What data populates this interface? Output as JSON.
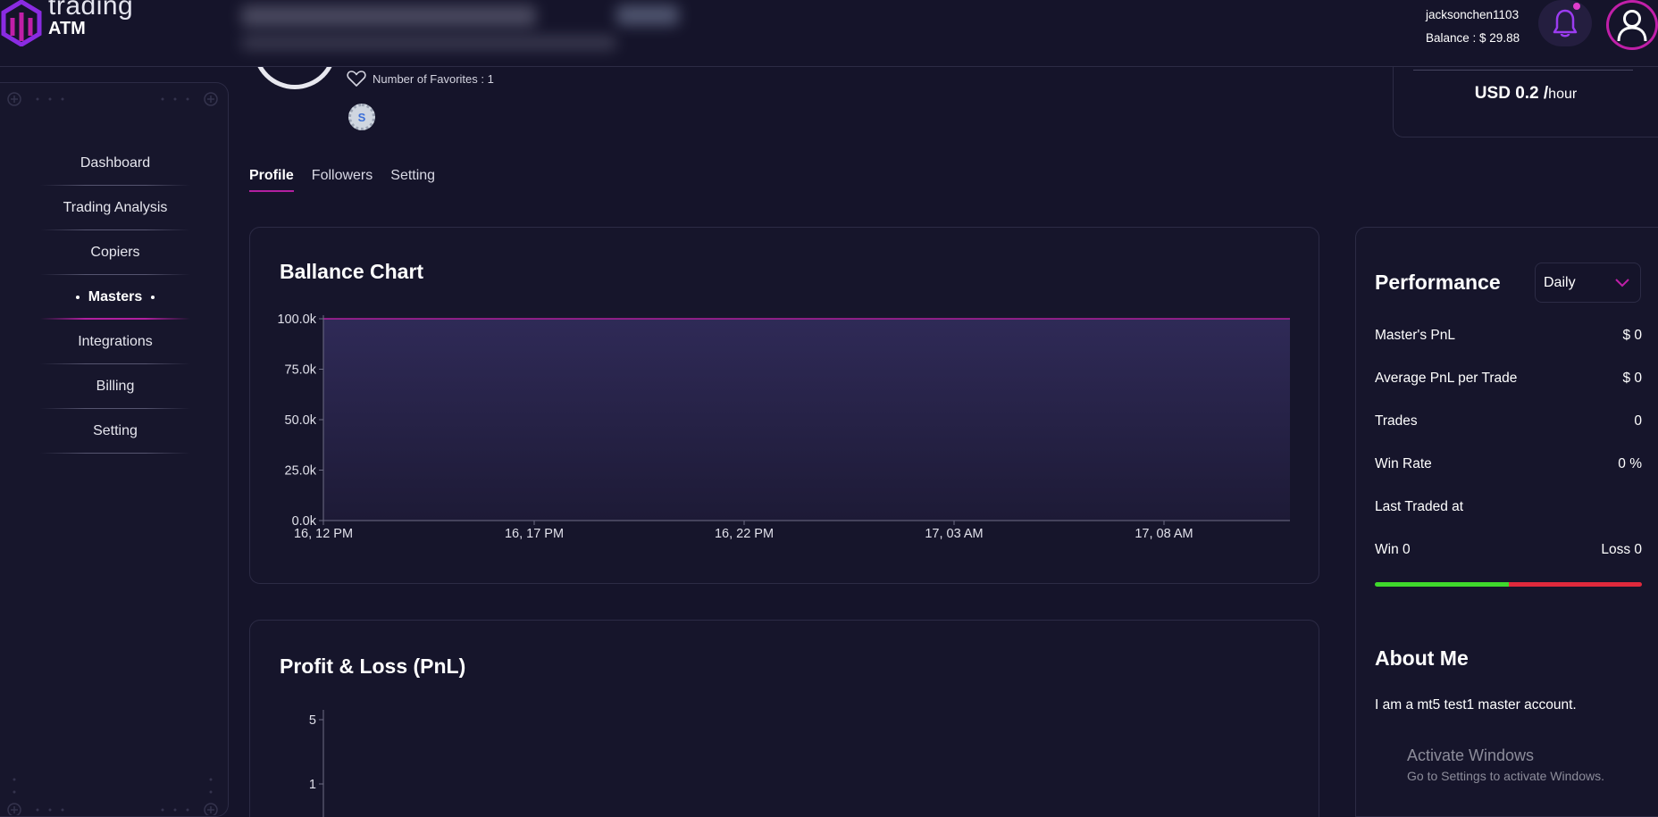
{
  "app": {
    "logo_word1": "trading",
    "logo_word2": "ATM",
    "accent_color": "#b21fa0"
  },
  "header": {
    "username": "jacksonchen1103",
    "balance": "Balance : $ 29.88",
    "bell_icon": "bell-icon",
    "avatar_icon": "user-icon"
  },
  "sidebar": {
    "items": [
      {
        "label": "Dashboard"
      },
      {
        "label": "Trading Analysis"
      },
      {
        "label": "Copiers"
      },
      {
        "label": "Masters",
        "active": true
      },
      {
        "label": "Integrations"
      },
      {
        "label": "Billing"
      },
      {
        "label": "Setting"
      }
    ]
  },
  "profile": {
    "favorites": "Number of Favorites : 1",
    "badge_letter": "S",
    "rate_value": "USD 0.2 /",
    "rate_unit": "hour"
  },
  "tabs": [
    {
      "label": "Profile",
      "active": true
    },
    {
      "label": "Followers"
    },
    {
      "label": "Setting"
    }
  ],
  "balance_chart": {
    "title": "Ballance Chart"
  },
  "pnl_chart": {
    "title": "Profit & Loss (PnL)"
  },
  "chart_data": [
    {
      "type": "area",
      "title": "Ballance Chart",
      "x": [
        "16, 12 PM",
        "16, 17 PM",
        "16, 22 PM",
        "17, 03 AM",
        "17, 08 AM"
      ],
      "yticks": [
        "0.0k",
        "25.0k",
        "50.0k",
        "75.0k",
        "100.0k"
      ],
      "ylim": [
        0,
        100000
      ],
      "series": [
        {
          "values": [
            100000,
            100000,
            100000,
            100000,
            100000,
            100000
          ]
        }
      ],
      "color": "#b21fa0",
      "grid": false
    },
    {
      "type": "line",
      "title": "Profit & Loss (PnL)",
      "yticks": [
        "5",
        "1"
      ],
      "grid": false
    }
  ],
  "performance": {
    "title": "Performance",
    "period": "Daily",
    "stats": [
      {
        "label": "Master's PnL",
        "value": "$ 0"
      },
      {
        "label": "Average PnL per Trade",
        "value": "$ 0"
      },
      {
        "label": "Trades",
        "value": "0"
      },
      {
        "label": "Win Rate",
        "value": "0 %"
      },
      {
        "label": "Last Traded at",
        "value": ""
      },
      {
        "label": "Win 0",
        "value": "Loss 0"
      }
    ],
    "win_ratio": 0.5,
    "win_color": "#3fd92c",
    "loss_color": "#e0293c"
  },
  "about": {
    "title": "About Me",
    "text": "I am a mt5 test1 master account."
  },
  "watermark": {
    "line1": "Activate Windows",
    "line2": "Go to Settings to activate Windows."
  }
}
